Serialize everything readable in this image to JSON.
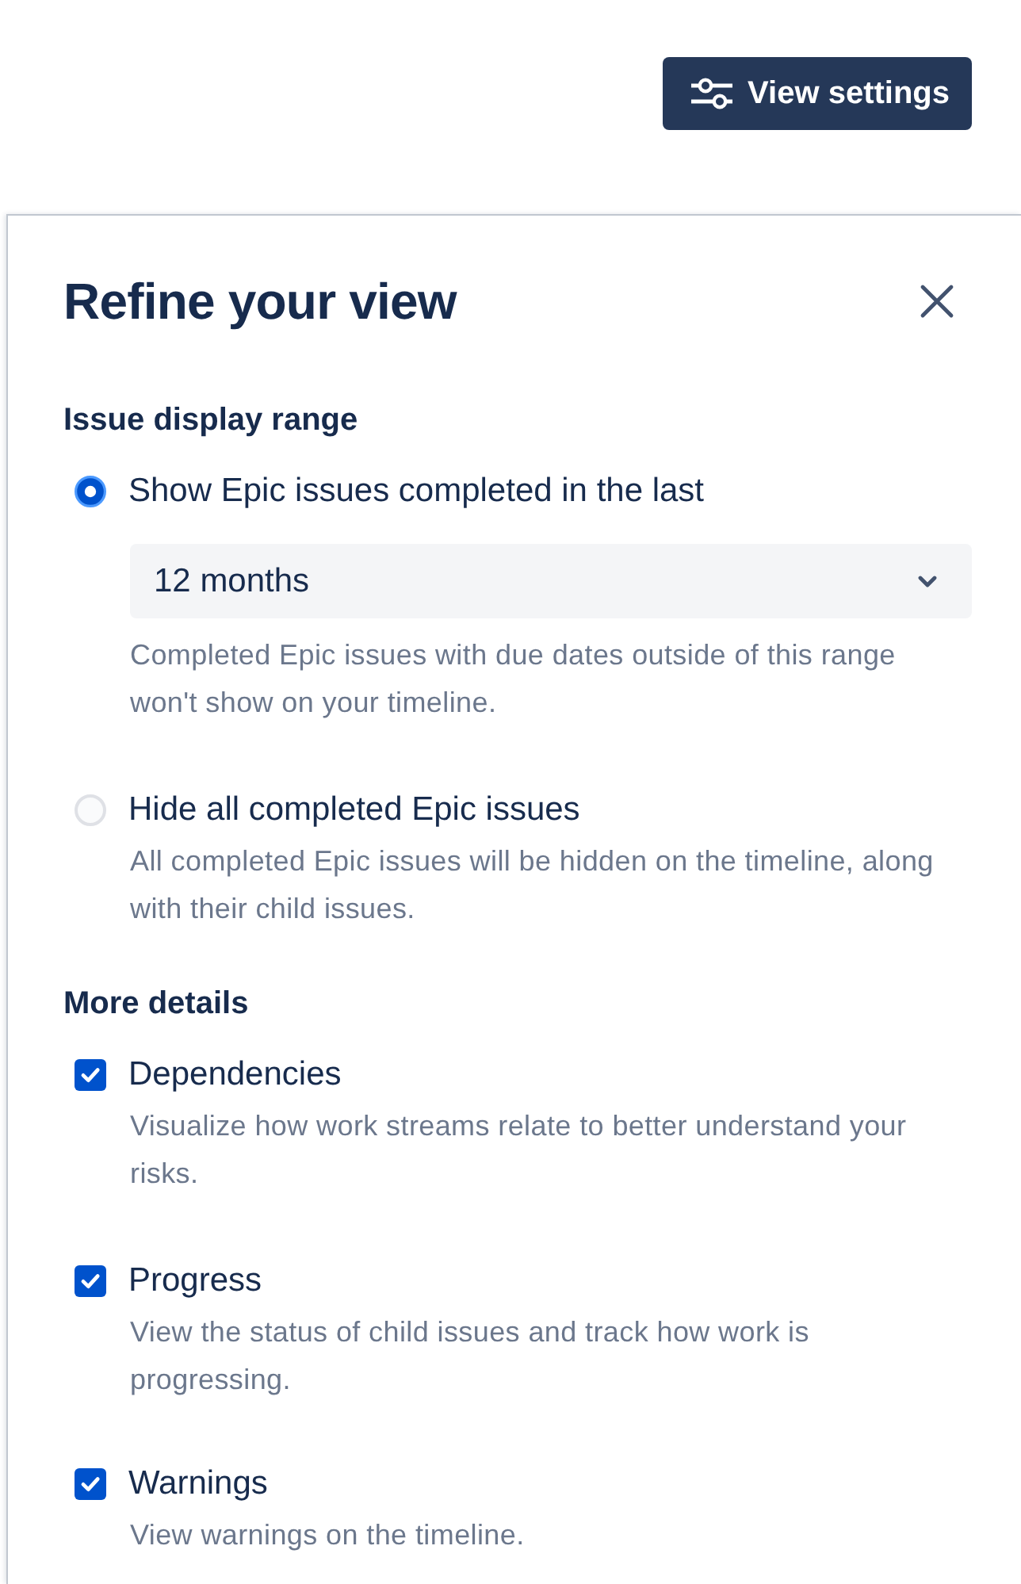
{
  "toolbar": {
    "view_settings_button": "View settings"
  },
  "panel": {
    "title": "Refine your view",
    "sections": [
      {
        "heading": "Issue display range",
        "kind": "radio",
        "options": [
          {
            "label": "Show Epic issues completed in the last",
            "selected": true,
            "select": {
              "value": "12 months"
            },
            "description": "Completed Epic issues with due dates outside of this range won't show on your timeline."
          },
          {
            "label": "Hide all completed Epic issues",
            "selected": false,
            "description": "All completed Epic issues will be hidden on the timeline, along with their child issues."
          }
        ]
      },
      {
        "heading": "More details",
        "kind": "checkbox",
        "options": [
          {
            "label": "Dependencies",
            "checked": true,
            "description": "Visualize how work streams relate to better understand your risks."
          },
          {
            "label": "Progress",
            "checked": true,
            "description": "View the status of child issues and track how work is progressing."
          },
          {
            "label": "Warnings",
            "checked": true,
            "description": "View warnings on the timeline."
          }
        ]
      }
    ]
  }
}
